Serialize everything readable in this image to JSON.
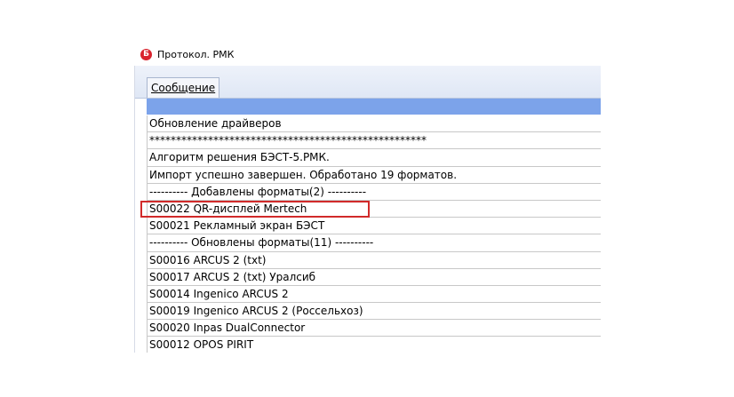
{
  "window": {
    "title": "Протокол. РМК",
    "app_icon_letter": "Б",
    "accent_color": "#7ca3ea",
    "highlight_color": "#d12a2a"
  },
  "tabs": [
    {
      "label": "Сообщение"
    }
  ],
  "rows": [
    "Обновление драйверов",
    "****************************************************",
    "Алгоритм решения БЭСТ-5.РМК.",
    "Импорт успешно завершен. Обработано 19 форматов.",
    "---------- Добавлены форматы(2) ----------",
    "S00022 QR-дисплей Mertech",
    "S00021 Рекламный экран БЭСТ",
    "---------- Обновлены форматы(11) ----------",
    "S00016 ARCUS 2 (txt)",
    "S00017 ARCUS 2 (txt) Уралсиб",
    "S00014 Ingenico ARCUS 2",
    "S00019 Ingenico ARCUS 2 (Россельхоз)",
    "S00020 Inpas DualConnector",
    "S00012 OPOS PIRIT"
  ],
  "highlighted_row_index": 5
}
